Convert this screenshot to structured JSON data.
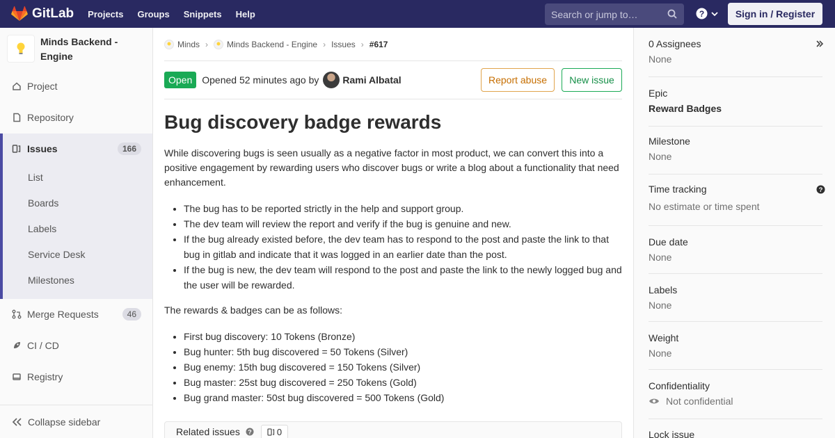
{
  "navbar": {
    "brand": "GitLab",
    "links": [
      "Projects",
      "Groups",
      "Snippets",
      "Help"
    ],
    "search_placeholder": "Search or jump to…",
    "signin": "Sign in / Register"
  },
  "sidebar": {
    "project_name_line1": "Minds Backend -",
    "project_name_line2": "Engine",
    "project": "Project",
    "repository": "Repository",
    "issues": "Issues",
    "issues_count": "166",
    "sub": [
      "List",
      "Boards",
      "Labels",
      "Service Desk",
      "Milestones"
    ],
    "merge_requests": "Merge Requests",
    "mr_count": "46",
    "cicd": "CI / CD",
    "registry": "Registry",
    "collapse": "Collapse sidebar"
  },
  "breadcrumb": [
    "Minds",
    "Minds Backend - Engine",
    "Issues",
    "#617"
  ],
  "issue": {
    "status": "Open",
    "opened": "Opened 52 minutes ago by",
    "author": "Rami Albatal",
    "report_abuse": "Report abuse",
    "new_issue": "New issue",
    "title": "Bug discovery badge rewards",
    "intro": "While discovering bugs is seen usually as a negative factor in most product, we can convert this into a positive engagement by rewarding users who discover bugs or write a blog about a functionality that need enhancement.",
    "rules": [
      "The bug has to be reported strictly in the help and support group.",
      "The dev team will review the report and verify if the bug is genuine and new.",
      "If the bug already existed before, the dev team has to respond to the post and paste the link to that bug in gitlab and indicate that it was logged in an earlier date than the post.",
      "If the bug is new, the dev team will respond to the post and paste the link to the newly logged bug and the user will be rewarded."
    ],
    "rewards_intro": "The rewards & badges can be as follows:",
    "rewards": [
      "First bug discovery: 10 Tokens (Bronze)",
      "Bug hunter: 5th bug discovered = 50 Tokens (Silver)",
      "Bug enemy: 15th bug discovered = 150 Tokens (Silver)",
      "Bug master: 25st bug discovered = 250 Tokens (Gold)",
      "Bug grand master: 50st bug discovered = 500 Tokens (Gold)"
    ],
    "related_label": "Related issues",
    "related_count": "0"
  },
  "right_sidebar": {
    "assignees_label": "0 Assignees",
    "assignees_value": "None",
    "epic_label": "Epic",
    "epic_value": "Reward Badges",
    "milestone_label": "Milestone",
    "milestone_value": "None",
    "time_label": "Time tracking",
    "time_value": "No estimate or time spent",
    "due_label": "Due date",
    "due_value": "None",
    "labels_label": "Labels",
    "labels_value": "None",
    "weight_label": "Weight",
    "weight_value": "None",
    "conf_label": "Confidentiality",
    "conf_value": "Not confidential",
    "lock_label": "Lock issue"
  },
  "colors": {
    "navbar": "#292961",
    "accent": "#4b4ba3",
    "open_status": "#1aaa55",
    "abuse": "#e0a44c"
  }
}
